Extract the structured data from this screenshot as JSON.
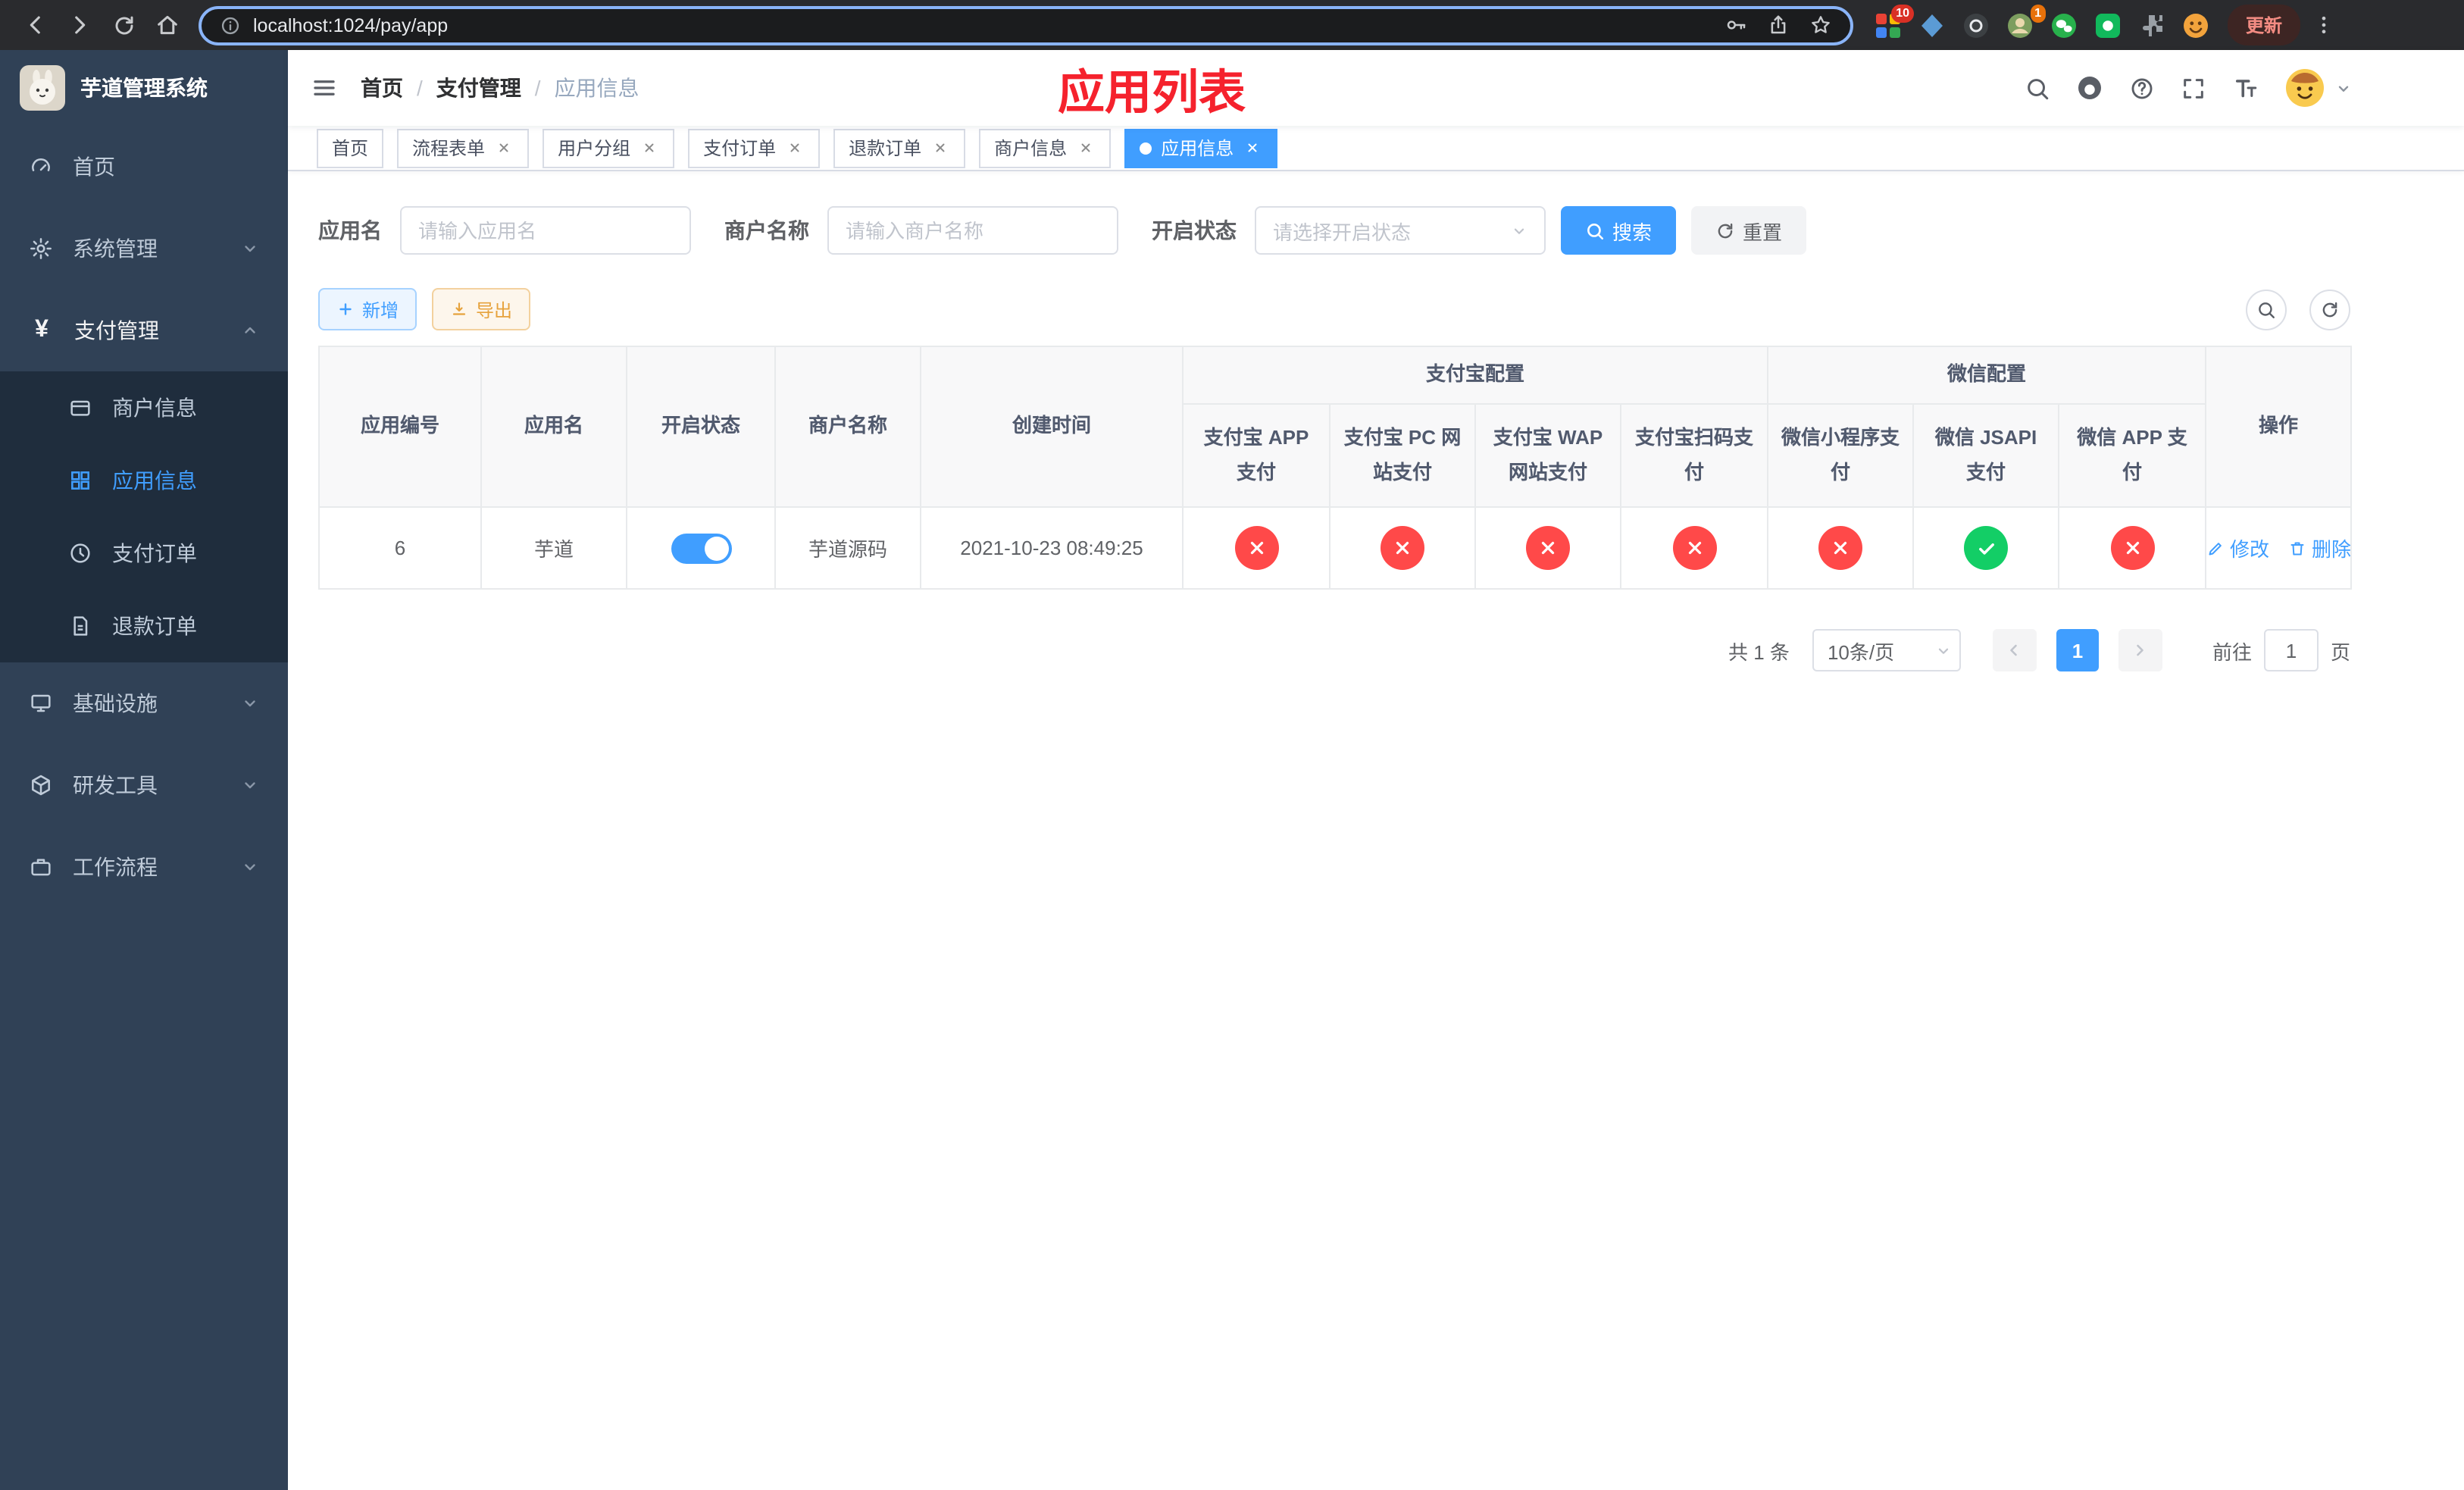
{
  "browser": {
    "url": "localhost:1024/pay/app",
    "update_label": "更新",
    "ext_badge_1": "10",
    "ext_badge_2": "1"
  },
  "sidebar": {
    "app_title": "芋道管理系统",
    "payment_icon_glyph": "¥",
    "items": [
      {
        "label": "首页"
      },
      {
        "label": "系统管理"
      },
      {
        "label": "支付管理"
      },
      {
        "label": "基础设施"
      },
      {
        "label": "研发工具"
      },
      {
        "label": "工作流程"
      }
    ],
    "payment_children": [
      {
        "label": "商户信息"
      },
      {
        "label": "应用信息"
      },
      {
        "label": "支付订单"
      },
      {
        "label": "退款订单"
      }
    ]
  },
  "header": {
    "breadcrumb": [
      "首页",
      "支付管理",
      "应用信息"
    ],
    "page_title": "应用列表"
  },
  "tabs": [
    {
      "label": "首页"
    },
    {
      "label": "流程表单"
    },
    {
      "label": "用户分组"
    },
    {
      "label": "支付订单"
    },
    {
      "label": "退款订单"
    },
    {
      "label": "商户信息"
    },
    {
      "label": "应用信息"
    }
  ],
  "filters": {
    "app_name_label": "应用名",
    "app_name_placeholder": "请输入应用名",
    "merchant_label": "商户名称",
    "merchant_placeholder": "请输入商户名称",
    "status_label": "开启状态",
    "status_placeholder": "请选择开启状态",
    "search_label": "搜索",
    "reset_label": "重置"
  },
  "toolbar": {
    "add_label": "新增",
    "export_label": "导出"
  },
  "table": {
    "headers": {
      "app_id": "应用编号",
      "app_name": "应用名",
      "status": "开启状态",
      "merchant_name": "商户名称",
      "create_time": "创建时间",
      "alipay_group": "支付宝配置",
      "wechat_group": "微信配置",
      "alipay_app": "支付宝 APP 支付",
      "alipay_pc": "支付宝 PC 网站支付",
      "alipay_wap": "支付宝 WAP 网站支付",
      "alipay_qr": "支付宝扫码支付",
      "wechat_mini": "微信小程序支付",
      "wechat_jsapi": "微信 JSAPI 支付",
      "wechat_app": "微信 APP 支付",
      "actions": "操作"
    },
    "row": {
      "app_id": "6",
      "app_name": "芋道",
      "status_on": true,
      "merchant_name": "芋道源码",
      "create_time": "2021-10-23 08:49:25",
      "pay_status": {
        "alipay_app": false,
        "alipay_pc": false,
        "alipay_wap": false,
        "alipay_qr": false,
        "wechat_mini": false,
        "wechat_jsapi": true,
        "wechat_app": false
      },
      "edit_label": "修改",
      "delete_label": "删除"
    }
  },
  "pagination": {
    "total": "共 1 条",
    "page_size": "10条/页",
    "page": "1",
    "goto_label": "前往",
    "goto_value": "1",
    "unit": "页"
  },
  "colors": {
    "primary": "#409eff",
    "success": "#13ce66",
    "danger": "#ff4949",
    "title_red": "#f5222d",
    "sidebar_bg": "#304156",
    "submenu_bg": "#1f2d3d"
  }
}
